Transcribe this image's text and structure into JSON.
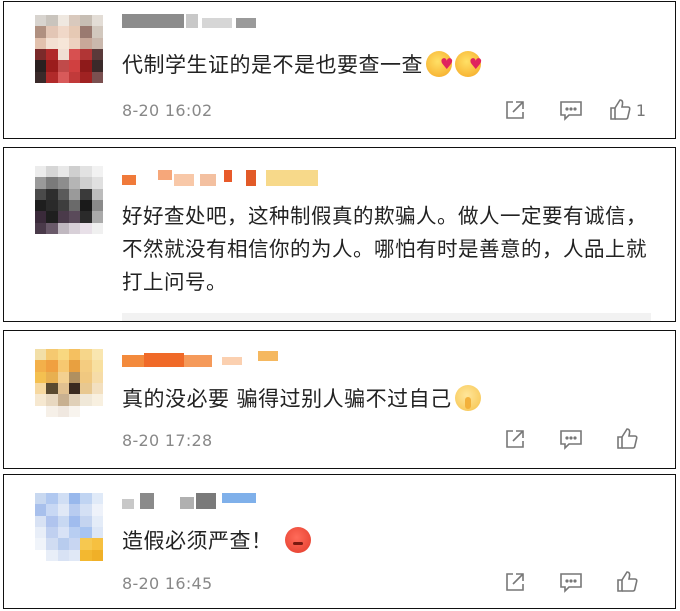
{
  "comments": [
    {
      "text": "代制学生证的是不是也要查一查",
      "emojis": [
        "blush-love-emoji",
        "blush-love-emoji"
      ],
      "time": "8-20 16:02",
      "likes": "1"
    },
    {
      "text": "好好查处吧，这种制假真的欺骗人。做人一定要有诚信，不然就没有相信你的为人。哪怕有时是善意的，人品上就打上问号。"
    },
    {
      "text": "真的没必要 骗得过别人骗不过自己",
      "emojis": [
        "shush-emoji"
      ],
      "time": "8-20 17:28",
      "likes": ""
    },
    {
      "text": "造假必须严查！",
      "emojis": [
        "angry-emoji"
      ],
      "time": "8-20 16:45",
      "likes": ""
    }
  ],
  "colors": {
    "border": "#111111",
    "meta_text": "#888888",
    "icon": "#777777"
  }
}
